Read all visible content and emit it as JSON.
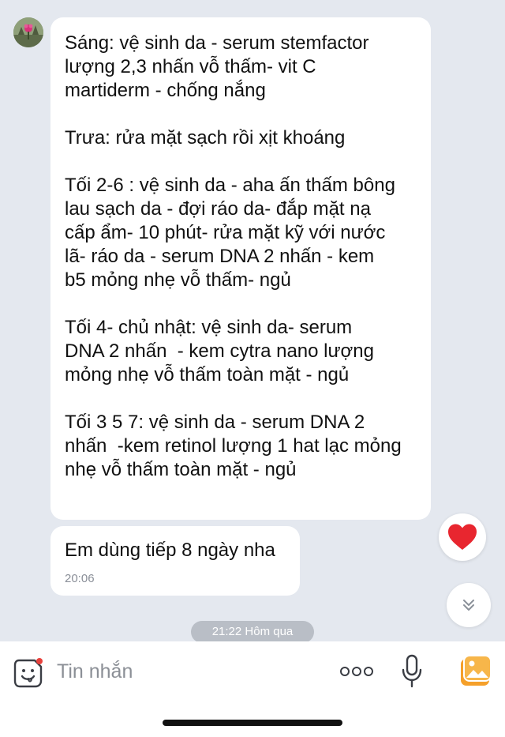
{
  "messages": [
    {
      "paragraphs": [
        "Sáng: vệ sinh da - serum stemfactor\nlượng 2,3 nhấn vỗ thấm- vit C\nmartiderm - chống nắng",
        "Trưa: rửa mặt sạch rồi xịt khoáng",
        "Tối 2-6 : vệ sinh da - aha ấn thấm bông\nlau sạch da - đợi ráo da- đắp mặt nạ\ncấp ẩm- 10 phút- rửa mặt kỹ với nước\nlã- ráo da - serum DNA 2 nhấn - kem\nb5 mỏng nhẹ vỗ thấm- ngủ",
        "Tối 4- chủ nhật: vệ sinh da- serum\nDNA 2 nhấn  - kem cytra nano lượng\nmỏng nhẹ vỗ thấm toàn mặt - ngủ",
        "Tối 3 5 7: vệ sinh da - serum DNA 2\nnhấn  -kem retinol lượng 1 hat lạc mỏng\nnhẹ vỗ thấm toàn mặt - ngủ"
      ]
    },
    {
      "text": "Em dùng tiếp 8 ngày nha",
      "time": "20:06"
    }
  ],
  "date_divider": "21:22 Hôm qua",
  "input": {
    "placeholder": "Tin nhắn"
  },
  "icons": {
    "reaction": "heart-icon",
    "scroll": "chevron-double-down-icon",
    "sticker": "sticker-icon",
    "more": "more-icon",
    "mic": "mic-icon",
    "image": "image-icon"
  },
  "colors": {
    "background": "#e4e8ef",
    "bubble": "#ffffff",
    "heart": "#e8262f",
    "image_icon": "#f5a02a",
    "sticker_dot": "#e8413c"
  }
}
